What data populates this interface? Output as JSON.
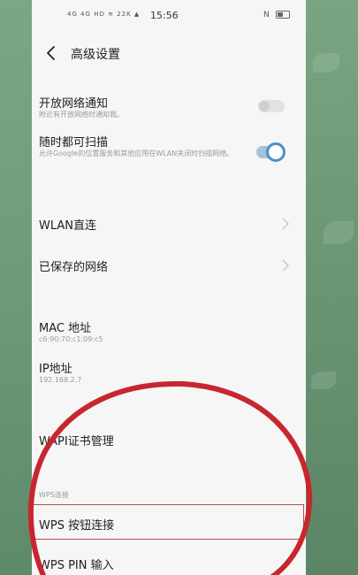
{
  "status_bar": {
    "icons_left": "4G 4G HD ≋ 22K ▲",
    "time": "15:56",
    "icons_right": "N"
  },
  "header": {
    "title": "高级设置"
  },
  "settings": {
    "open_network_notify": {
      "title": "开放网络通知",
      "subtitle": "附近有开放网络时通知我。",
      "enabled": false
    },
    "scan_anytime": {
      "title": "随时都可扫描",
      "subtitle": "允许Google的位置服务和其他应用在WLAN关闭时扫描网络。",
      "enabled": true
    },
    "wlan_direct": {
      "title": "WLAN直连"
    },
    "saved_networks": {
      "title": "已保存的网络"
    },
    "mac_address": {
      "title": "MAC 地址",
      "value": "c6:90:70:c1:09:c5"
    },
    "ip_address": {
      "title": "IP地址",
      "value": "192.168.2.7"
    },
    "wapi_cert": {
      "title": "WAPI证书管理"
    },
    "wps_section": {
      "label": "WPS连接"
    },
    "wps_button": {
      "title": "WPS 按钮连接"
    },
    "wps_pin": {
      "title": "WPS PIN 输入"
    }
  },
  "colors": {
    "accent": "#4d8fc9",
    "annotation": "#c8262e",
    "highlight": "#c24848"
  }
}
